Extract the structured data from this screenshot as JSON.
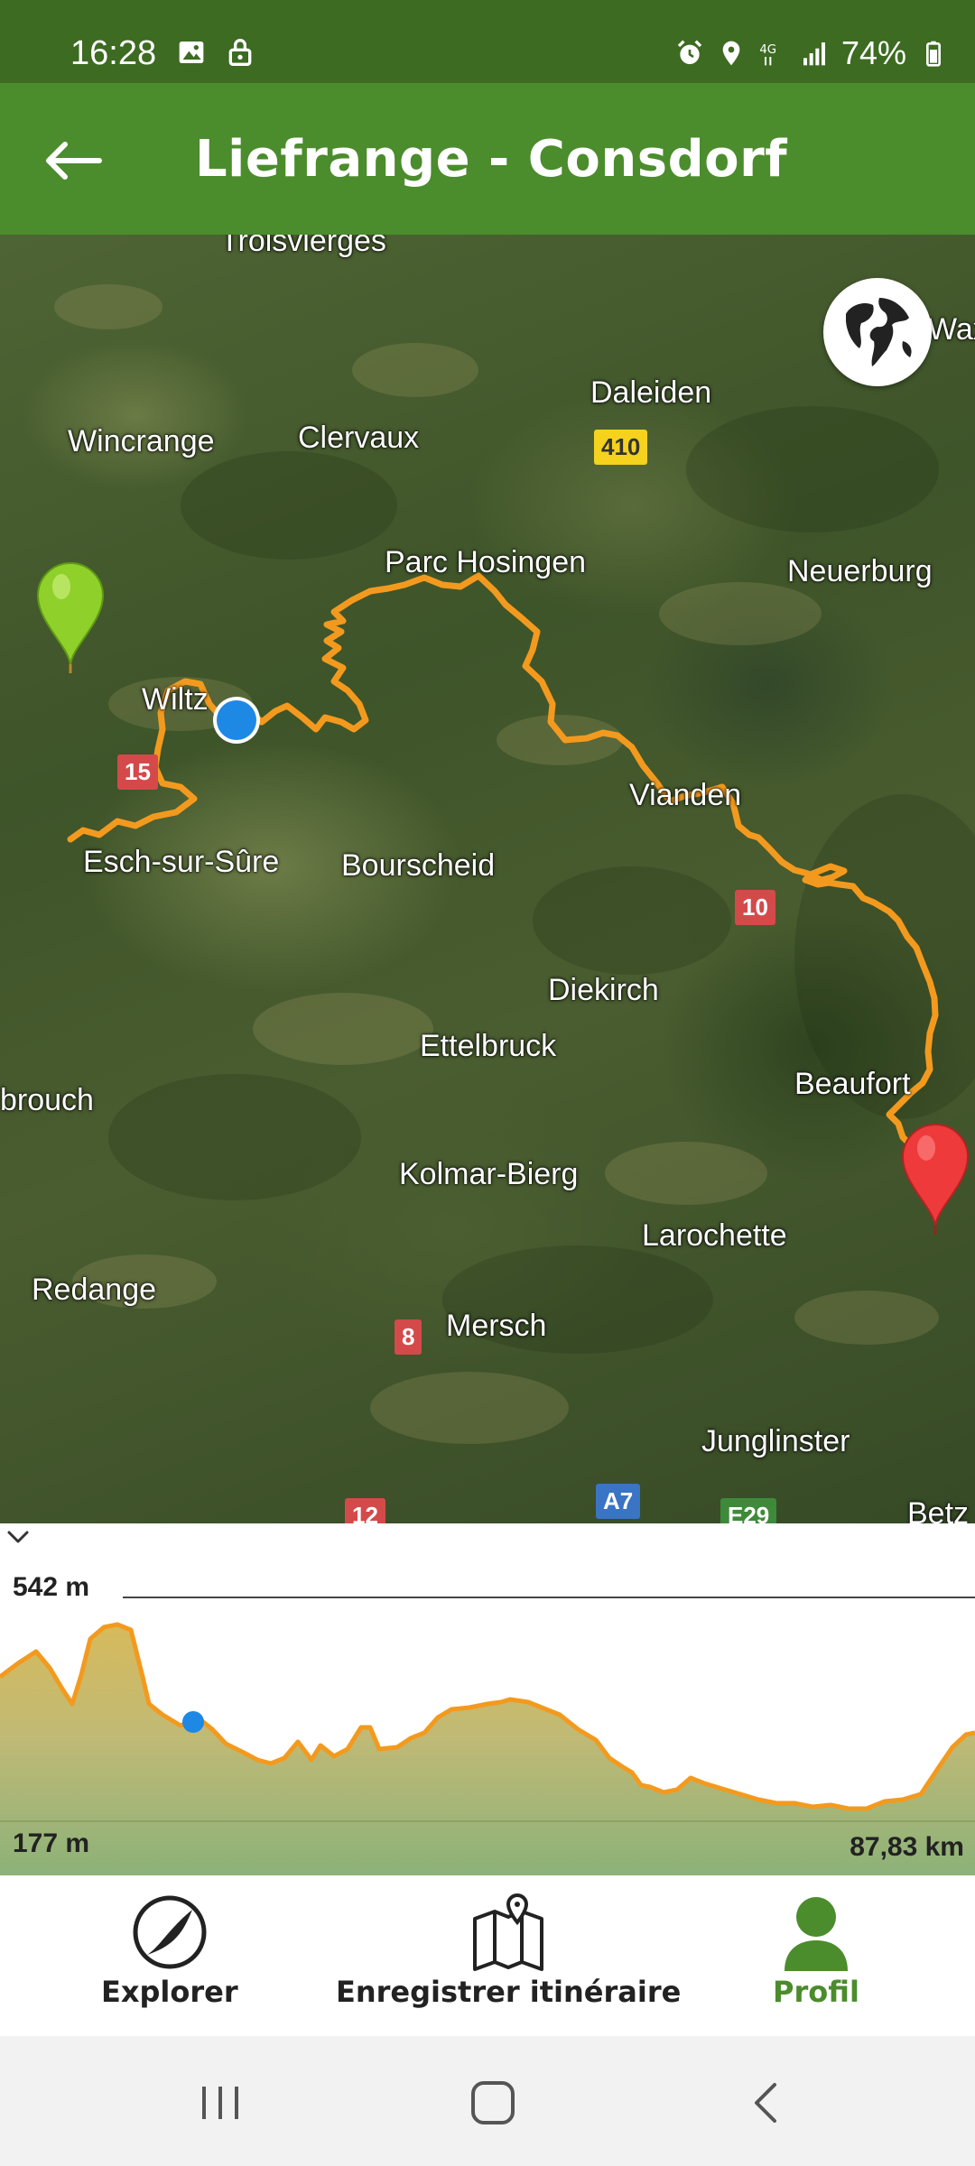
{
  "status_bar": {
    "time": "16:28",
    "battery": "74%",
    "left_icons": [
      "image-icon",
      "lock-icon"
    ],
    "right_icons": [
      "alarm-icon",
      "location-icon",
      "network-4g-icon",
      "signal-icon",
      "battery-icon"
    ]
  },
  "app_bar": {
    "title": "Liefrange - Consdorf",
    "back_icon": "arrow-left-icon"
  },
  "map": {
    "places": [
      {
        "id": "troisvierges",
        "label": "Troisvierges"
      },
      {
        "id": "daleiden",
        "label": "Daleiden"
      },
      {
        "id": "wincrange",
        "label": "Wincrange"
      },
      {
        "id": "clervaux",
        "label": "Clervaux"
      },
      {
        "id": "parc-hosingen",
        "label": "Parc Hosingen"
      },
      {
        "id": "neuerburg",
        "label": "Neuerburg"
      },
      {
        "id": "wiltz",
        "label": "Wiltz"
      },
      {
        "id": "vianden",
        "label": "Vianden"
      },
      {
        "id": "esch-sur-sure",
        "label": "Esch-sur-Sûre"
      },
      {
        "id": "bourscheid",
        "label": "Bourscheid"
      },
      {
        "id": "diekirch",
        "label": "Diekirch"
      },
      {
        "id": "ettelbruck",
        "label": "Ettelbruck"
      },
      {
        "id": "beaufort",
        "label": "Beaufort"
      },
      {
        "id": "brouch",
        "label": "brouch"
      },
      {
        "id": "kolmar-bierg",
        "label": "Kolmar-Bierg"
      },
      {
        "id": "larochette",
        "label": "Larochette"
      },
      {
        "id": "redange",
        "label": "Redange"
      },
      {
        "id": "mersch",
        "label": "Mersch"
      },
      {
        "id": "junglinster",
        "label": "Junglinster"
      },
      {
        "id": "wax",
        "label": "Wax"
      },
      {
        "id": "betz",
        "label": "Betz"
      }
    ],
    "road_badges": [
      {
        "id": "r410",
        "label": "410",
        "color": "#f4d21e"
      },
      {
        "id": "r15",
        "label": "15",
        "color": "#d44a4a"
      },
      {
        "id": "r10",
        "label": "10",
        "color": "#d44a4a"
      },
      {
        "id": "r8",
        "label": "8",
        "color": "#d44a4a"
      },
      {
        "id": "r12",
        "label": "12",
        "color": "#d44a4a"
      },
      {
        "id": "a7",
        "label": "A7",
        "color": "#3a74c4"
      },
      {
        "id": "e29",
        "label": "E29",
        "color": "#3f8a3a"
      }
    ],
    "route_color": "#f39a1e",
    "start_pin_color": "#8fd12a",
    "end_pin_color": "#ee3a3a",
    "current_position_color": "#1e88e5",
    "globe_icon": "globe-icon"
  },
  "elevation": {
    "max_label": "542 m",
    "min_label": "177 m",
    "distance_label": "87,83 km",
    "collapse_icon": "chevron-down-icon"
  },
  "bottom_nav": {
    "items": [
      {
        "label": "Explorer",
        "icon": "explore-icon",
        "active": false
      },
      {
        "label": "Enregistrer itinéraire",
        "icon": "map-pin-icon",
        "active": false
      },
      {
        "label": "Profil",
        "icon": "person-icon",
        "active": true
      }
    ],
    "active_color": "#4b8c2c"
  },
  "system_nav": {
    "buttons": [
      "recents-icon",
      "home-icon",
      "back-icon"
    ]
  }
}
